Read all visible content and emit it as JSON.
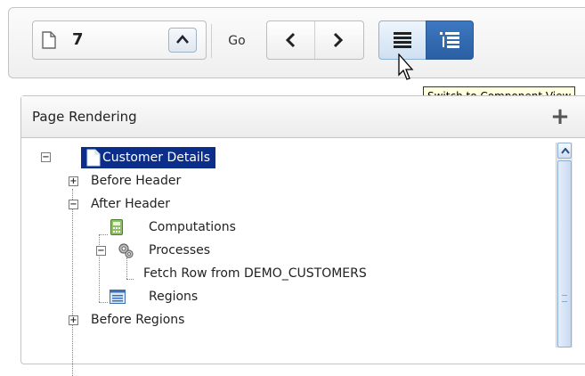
{
  "toolbar": {
    "page_number": "7",
    "go_label": "Go",
    "tooltip": "Switch to Component View"
  },
  "panel": {
    "title": "Page Rendering",
    "add_icon": "plus-icon"
  },
  "tree": {
    "root": "Customer Details",
    "before_header": "Before Header",
    "after_header": "After Header",
    "computations": "Computations",
    "processes": "Processes",
    "fetch_row": "Fetch Row from DEMO_CUSTOMERS",
    "regions": "Regions",
    "before_regions": "Before Regions"
  },
  "colors": {
    "selection": "#0a2e8a",
    "active_button": "#2a5fa3"
  }
}
